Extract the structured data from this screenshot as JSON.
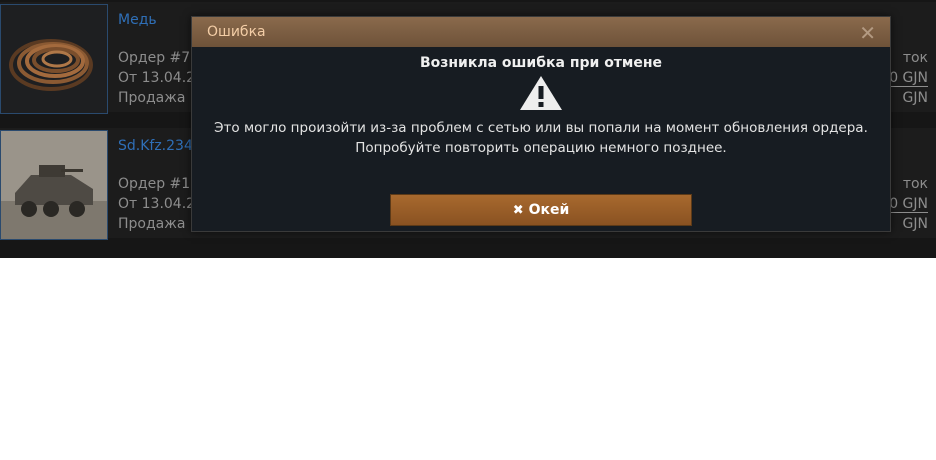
{
  "orders": [
    {
      "item_name": "Медь",
      "order_line": "Ордер #7",
      "date_line": "От 13.04.2",
      "type_line": "Продажа",
      "right_top": "ток",
      "right_mid": "0 GJN",
      "right_bottom": "GJN"
    },
    {
      "item_name": "Sd.Kfz.234",
      "order_line": "Ордер #1",
      "date_line": "От 13.04.2",
      "type_line": "Продажа",
      "right_top": "ток",
      "right_mid": "0 GJN",
      "right_bottom": "GJN"
    }
  ],
  "modal": {
    "title": "Ошибка",
    "close_symbol": "✕",
    "heading": "Возникла ошибка при отмене",
    "message_line1": "Это могло произойти из-за проблем с сетью или вы попали на момент обновления ордера.",
    "message_line2": "Попробуйте повторить операцию немного позднее.",
    "ok_icon": "✖",
    "ok_label": "Окей"
  },
  "colors": {
    "accent": "#9a5e27",
    "header": "#7c5e43",
    "link": "#2f6fb7",
    "dialog_bg": "#171c22"
  },
  "icons": {
    "warning": "warning-triangle-icon",
    "close": "close-icon",
    "ok": "x-mark-icon"
  }
}
